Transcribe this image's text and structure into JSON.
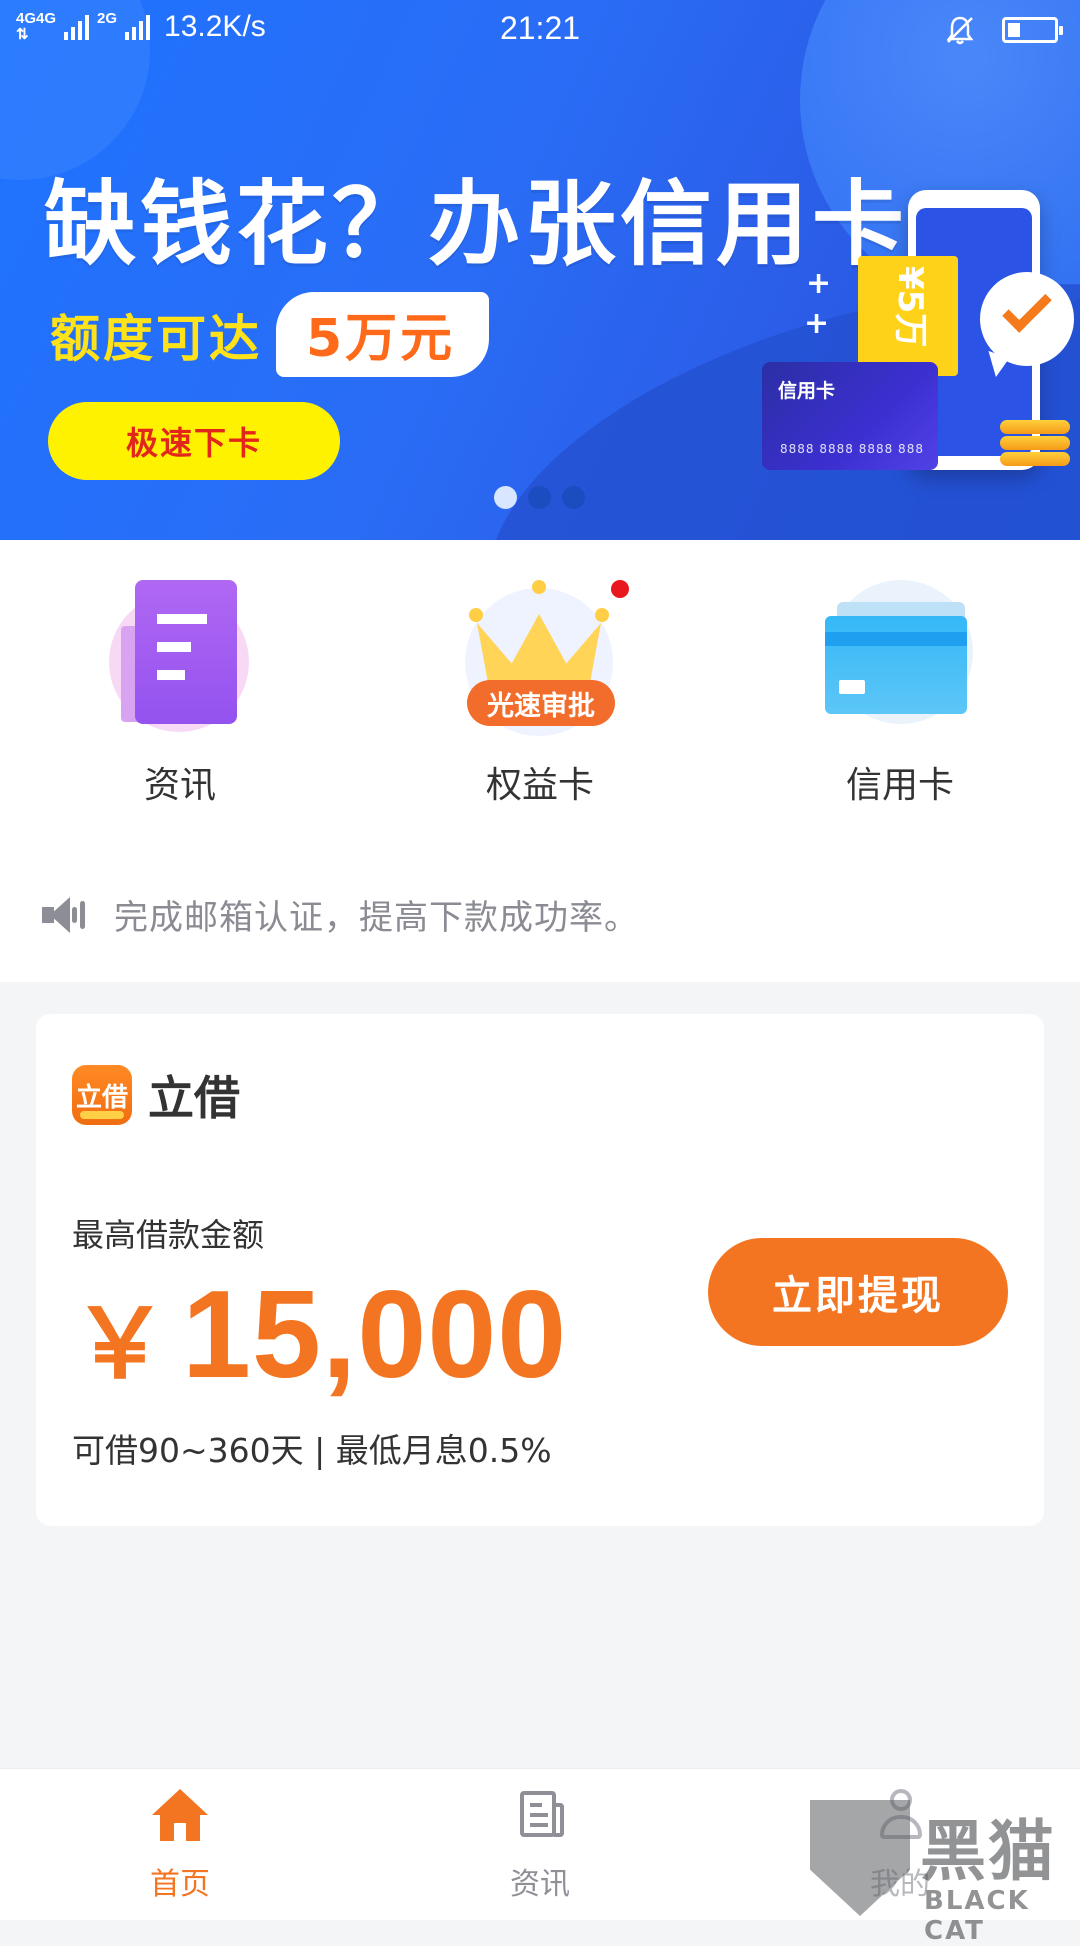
{
  "status_bar": {
    "network_1": "4G",
    "network_2": "4G",
    "network_3": "2G",
    "speed": "13.2K/s",
    "time": "21:21"
  },
  "banner": {
    "headline": "缺钱花？办张信用卡",
    "limit_text": "额度可达",
    "limit_amount": "5万元",
    "cta": "极速下卡",
    "card_title": "信用卡",
    "card_number": "8888 8888 8888 888",
    "ticket_text": "¥5万",
    "active_dot_index": 0,
    "dot_count": 3
  },
  "quick_entries": [
    {
      "label": "资讯",
      "icon": "document-icon"
    },
    {
      "label": "权益卡",
      "icon": "crown-icon",
      "badge": "光速审批"
    },
    {
      "label": "信用卡",
      "icon": "credit-card-icon"
    }
  ],
  "notice": {
    "icon": "speaker-icon",
    "text": "完成邮箱认证，提高下款成功率。"
  },
  "loan_card": {
    "brand_logo_text": "立借",
    "brand_name": "立借",
    "max_label": "最高借款金额",
    "currency": "￥",
    "amount": "15,000",
    "terms": "可借90~360天 | 最低月息0.5%",
    "cta": "立即提现"
  },
  "tab_bar": {
    "tabs": [
      {
        "label": "首页",
        "icon": "home-icon",
        "active": true
      },
      {
        "label": "资讯",
        "icon": "news-icon",
        "active": false
      },
      {
        "label": "我的",
        "icon": "user-icon",
        "active": false
      }
    ]
  },
  "watermark": {
    "cn": "黑猫",
    "en": "BLACK CAT"
  },
  "colors": {
    "accent": "#f47521",
    "banner_blue": "#2a6cf5",
    "cta_yellow": "#fff200"
  }
}
